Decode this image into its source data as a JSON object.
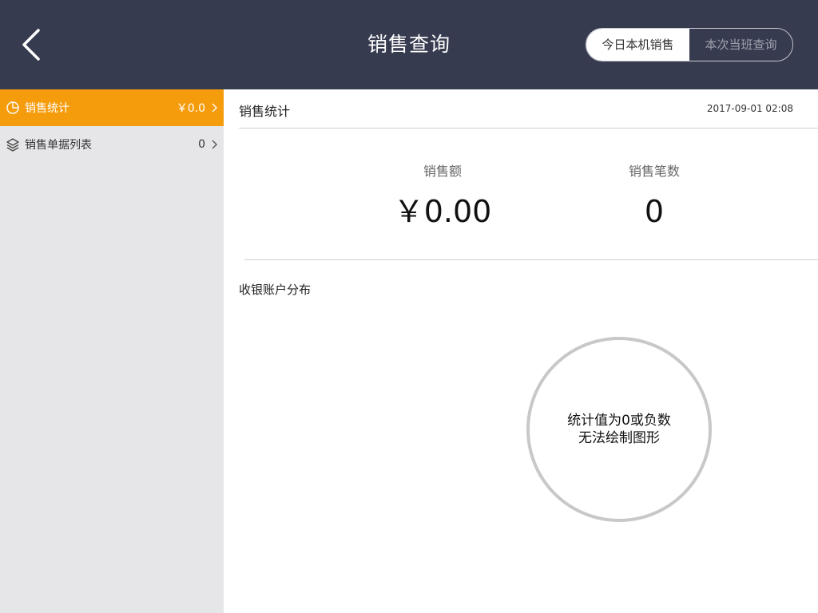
{
  "header": {
    "title": "销售查询",
    "back_icon": "chevron-left",
    "tabs": [
      {
        "label": "今日本机销售",
        "active": true
      },
      {
        "label": "本次当班查询",
        "active": false
      }
    ]
  },
  "sidebar": {
    "items": [
      {
        "label": "销售统计",
        "value": "￥0.0",
        "icon": "pie-chart-icon",
        "active": true
      },
      {
        "label": "销售单据列表",
        "value": "0",
        "icon": "layers-icon",
        "active": false
      }
    ]
  },
  "main": {
    "section_title": "销售统计",
    "datetime": "2017-09-01 02:08",
    "stats": {
      "amount_label": "销售额",
      "amount_value": "￥0.00",
      "count_label": "销售笔数",
      "count_value": "0"
    },
    "distribution": {
      "title": "收银账户分布",
      "empty_line1": "统计值为0或负数",
      "empty_line2": "无法绘制图形"
    }
  },
  "colors": {
    "header_bg": "#373b4f",
    "accent": "#f59c0d",
    "sidebar_bg": "#e6e6e8",
    "divider": "#d0d0d0",
    "pie_ring": "#c8c8c8"
  }
}
